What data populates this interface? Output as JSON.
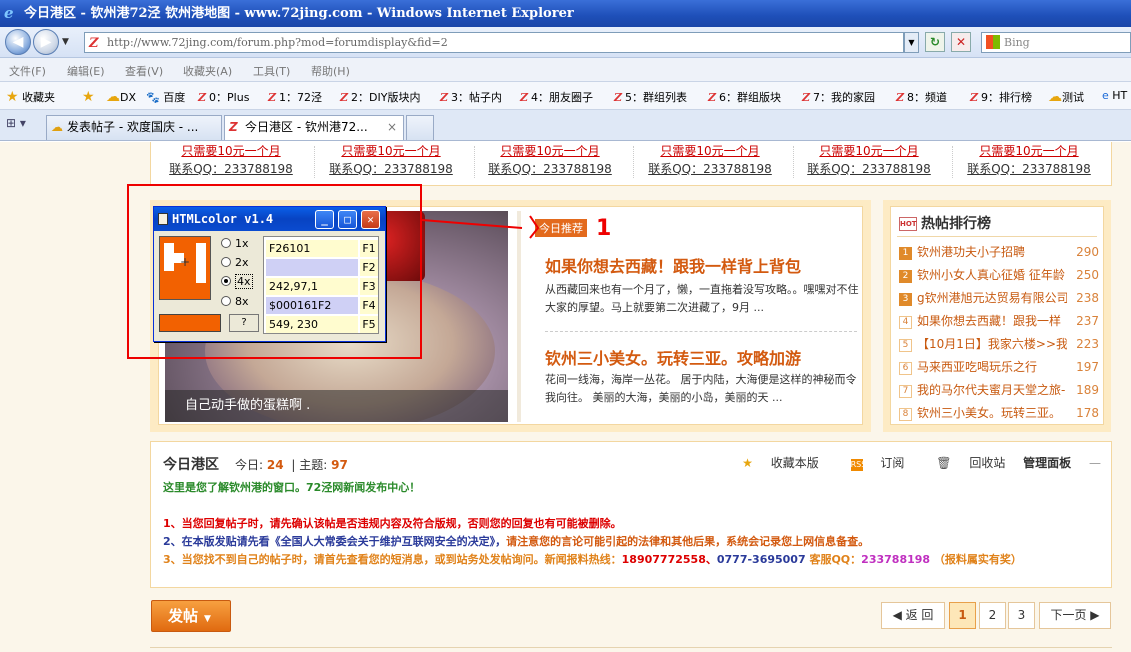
{
  "window": {
    "title": "今日港区 - 钦州港72泾 钦州港地图 - www.72jing.com - Windows Internet Explorer"
  },
  "address": {
    "url": "http://www.72jing.com/forum.php?mod=forumdisplay&fid=2",
    "search_placeholder": "Bing"
  },
  "menu": [
    "文件(F)",
    "编辑(E)",
    "查看(V)",
    "收藏夹(A)",
    "工具(T)",
    "帮助(H)"
  ],
  "favorites": {
    "label": "收藏夹",
    "items": [
      "DX",
      "百度",
      "0：Plus",
      "1：72泾",
      "2：DIY版块内",
      "3：帖子内",
      "4：朋友圈子",
      "5：群组列表",
      "6：群组版块",
      "7：我的家园",
      "8：频道",
      "9：排行榜",
      "测试",
      "HT"
    ]
  },
  "tabs": [
    {
      "label": "发表帖子 - 欢度国庆 - ..."
    },
    {
      "label": "今日港区 - 钦州港72...",
      "close": "×"
    }
  ],
  "ads": {
    "line1": "只需要10元一个月",
    "line2": "联系QQ：233788198"
  },
  "featured": {
    "photo_caption": "自己动手做的蛋糕啊 .",
    "tag": "今日推荐",
    "annotation": "1",
    "headline1": "如果你想去西藏！跟我一样背上背包",
    "summary1": "从西藏回来也有一个月了，懒，一直拖着没写攻略。。嘿嘿对不住大家的厚望。马上就要第二次进藏了，9月 ...",
    "headline2": "钦州三小美女。玩转三亚。攻略加游",
    "summary2": "花间一线海，海岸一丛花。 居于内陆，大海便是这样的神秘而令我向往。 美丽的大海，美丽的小岛，美丽的天 ..."
  },
  "hot": {
    "title": "热帖排行榜",
    "icon_text": "HOT",
    "items": [
      {
        "rank": "1",
        "title": "钦州港功夫小子招聘",
        "count": "290"
      },
      {
        "rank": "2",
        "title": "钦州小女人真心征婚 征年龄",
        "count": "250"
      },
      {
        "rank": "3",
        "title": "g钦州港旭元达贸易有限公司",
        "count": "238"
      },
      {
        "rank": "4",
        "title": "如果你想去西藏！跟我一样",
        "count": "237"
      },
      {
        "rank": "5",
        "title": "【10月1日】我家六楼>>我",
        "count": "223"
      },
      {
        "rank": "6",
        "title": "马来西亚吃喝玩乐之行",
        "count": "197"
      },
      {
        "rank": "7",
        "title": "我的马尔代夫蜜月天堂之旅-",
        "count": "189"
      },
      {
        "rank": "8",
        "title": "钦州三小美女。玩转三亚。",
        "count": "178"
      }
    ]
  },
  "forum": {
    "title": "今日港区",
    "today_label": "今日:",
    "today_value": "24",
    "topics_label": "主题:",
    "topics_value": "97",
    "actions": {
      "favorite": "收藏本版",
      "subscribe": "订阅",
      "recycle": "回收站",
      "admin": "管理面板",
      "collapse": "—"
    },
    "description": "这里是您了解钦州港的窗口。72泾网新闻发布中心！",
    "rule1": "1、当您回复帖子时，请先确认该帖是否违规内容及符合版规，否则您的回复也有可能被删除。",
    "rule2a": "2、在本版发贴请先看《全国人大常委会关于维护互联网安全的决定》，",
    "rule2b": "请注意您的言论可能引起的法律和其他后果，系统会记录您上网信息备查。",
    "rule3a": "3、当您找不到自己的帖子时，请首先查看您的短消息，或到站务处发帖询问。新闻报料热线：",
    "rule3_phone": "18907772558",
    "rule3_sep": "、",
    "rule3_tel": "0777-3695007",
    "rule3_qq_label": " 客服QQ：",
    "rule3_qq": "233788198",
    "rule3_tail": "（报料属实有奖）"
  },
  "post_button": {
    "label": "发帖",
    "caret": "▼"
  },
  "pager": {
    "back": "◀ 返 回",
    "pages": [
      "1",
      "2",
      "3"
    ],
    "next": "下一页 ▶",
    "current": "1"
  },
  "htmlcolor": {
    "title": "HTMLcolor v1.4",
    "zoom_options": [
      "1x",
      "2x",
      "4x",
      "8x"
    ],
    "zoom_selected": "4x",
    "help": "?",
    "fields": [
      {
        "value": "F26101",
        "key": "F1"
      },
      {
        "value": "",
        "key": "F2"
      },
      {
        "value": "242,97,1",
        "key": "F3"
      },
      {
        "value": "$000161F2",
        "key": "F4"
      },
      {
        "value": "549, 230",
        "key": "F5"
      }
    ],
    "picked_color": "#F26101"
  },
  "colors": {
    "accent": "#d35a10",
    "annotation_red": "#e00000",
    "panel_bg": "#fdebc4"
  }
}
